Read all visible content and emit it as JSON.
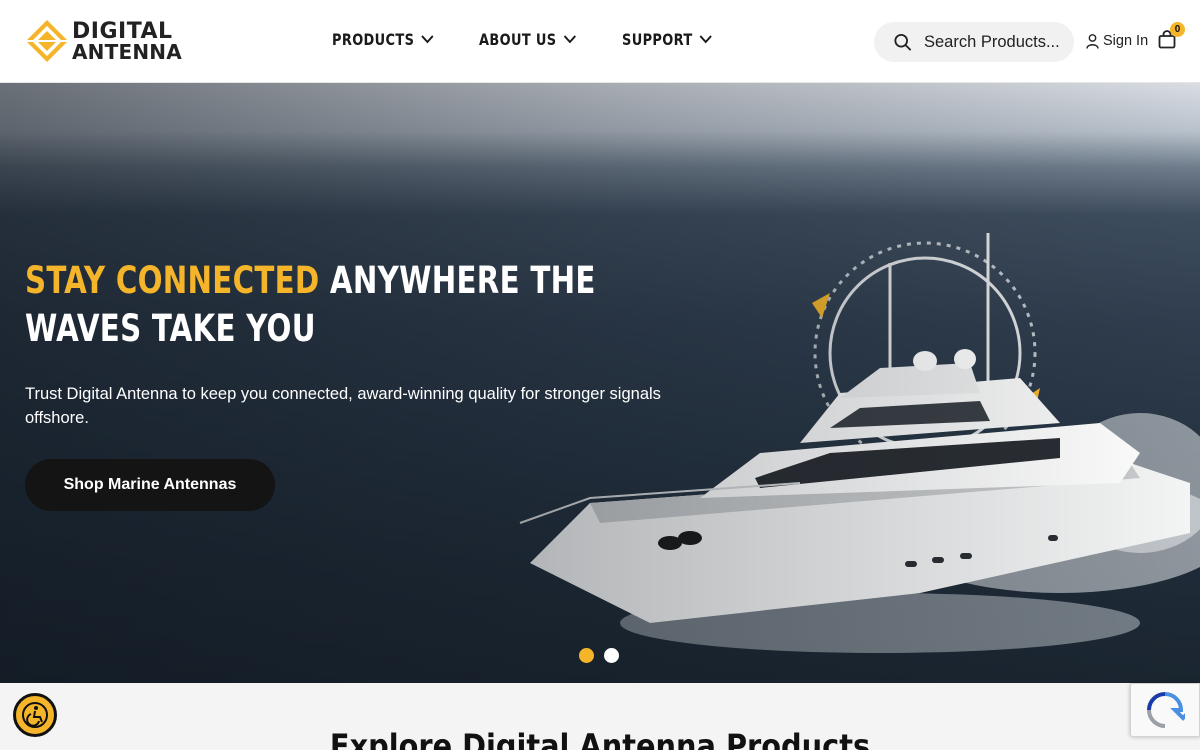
{
  "header": {
    "logo": {
      "line1": "DIGITAL",
      "line2": "ANTENNA"
    },
    "nav": [
      {
        "label": "PRODUCTS"
      },
      {
        "label": "ABOUT US"
      },
      {
        "label": "SUPPORT"
      }
    ],
    "search": {
      "placeholder": "Search Products..."
    },
    "sign_in": "Sign In",
    "cart_count": "0"
  },
  "hero": {
    "title_accent": "STAY CONNECTED",
    "title_rest": " ANYWHERE THE WAVES TAKE YOU",
    "subtitle": "Trust Digital Antenna to keep you connected, award-winning quality for stronger signals offshore.",
    "cta": "Shop Marine Antennas",
    "slides_total": 2,
    "active_slide": 1
  },
  "section": {
    "title": "Explore Digital Antenna Products"
  },
  "icons": {
    "search": "search-icon",
    "user": "user-icon",
    "cart": "shopping-bag-icon",
    "chevron": "chevron-down-icon",
    "accessibility": "accessibility-icon",
    "recaptcha": "recaptcha-icon"
  },
  "colors": {
    "accent": "#f5b52b",
    "button_dark": "#141414",
    "text_dark": "#1a1a1a"
  }
}
